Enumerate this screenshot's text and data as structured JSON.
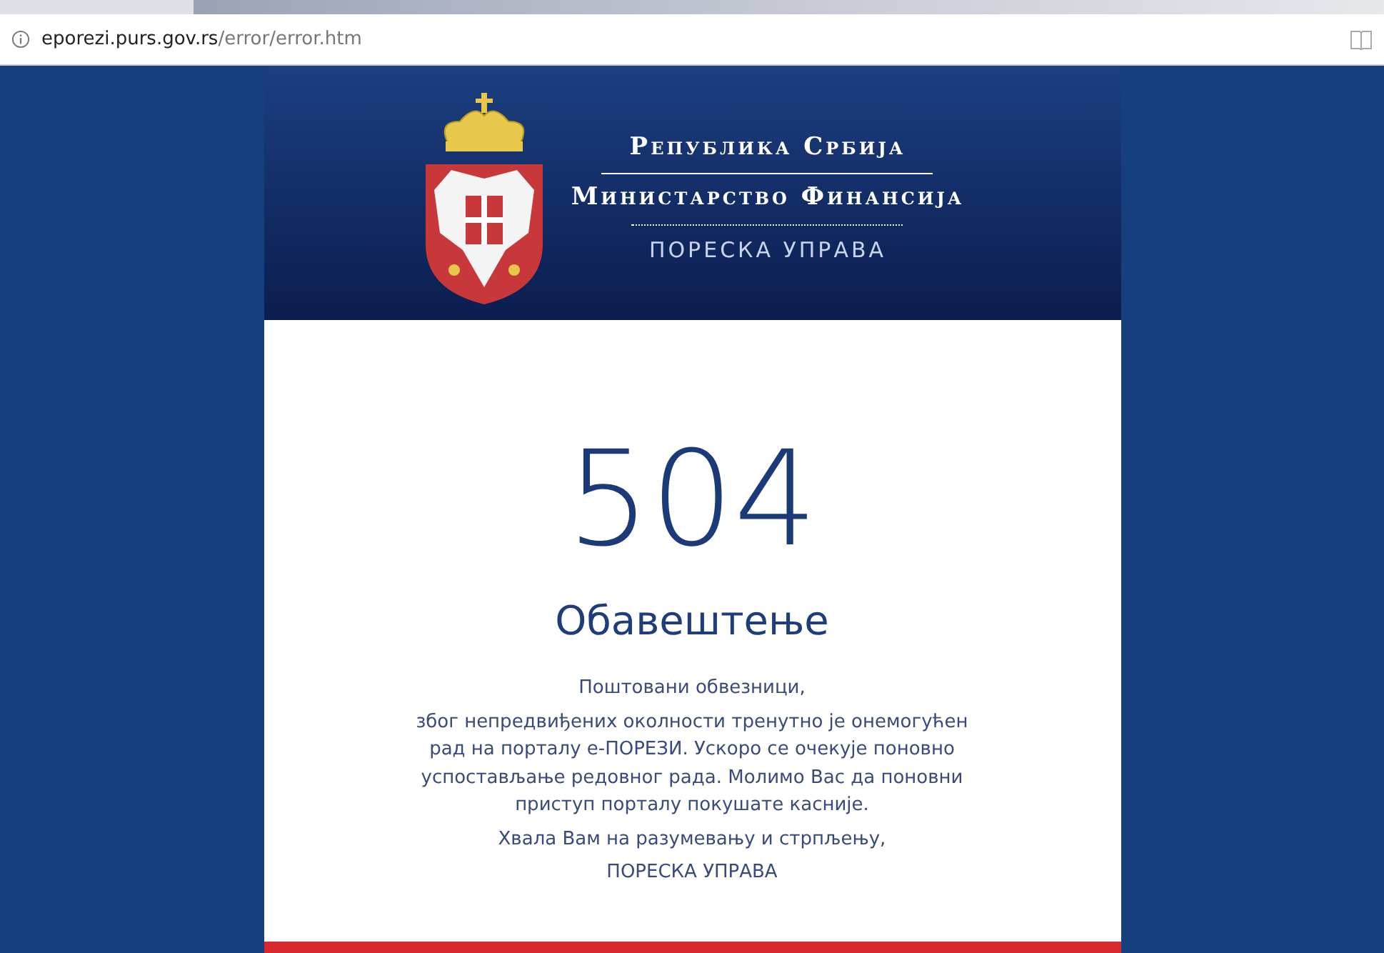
{
  "address_bar": {
    "host": "eporezi.purs.gov.rs",
    "path": "/error/error.htm"
  },
  "header": {
    "country": "Република Србија",
    "ministry": "Министарство Финансија",
    "agency": "ПОРЕСКА УПРАВА"
  },
  "error": {
    "code": "504",
    "title": "Обавештење",
    "greeting": "Поштовани обвезници,",
    "message": "због непредвиђених околности тренутно је онемогућен рад на порталу е-ПОРЕЗИ. Ускоро се очекује поновно успостављање редовног рада. Молимо Вас да поновни приступ порталу покушате касније.",
    "thanks": "Хвала Вам на разумевању и стрпљењу,",
    "signature": "ПОРЕСКА УПРАВА"
  }
}
